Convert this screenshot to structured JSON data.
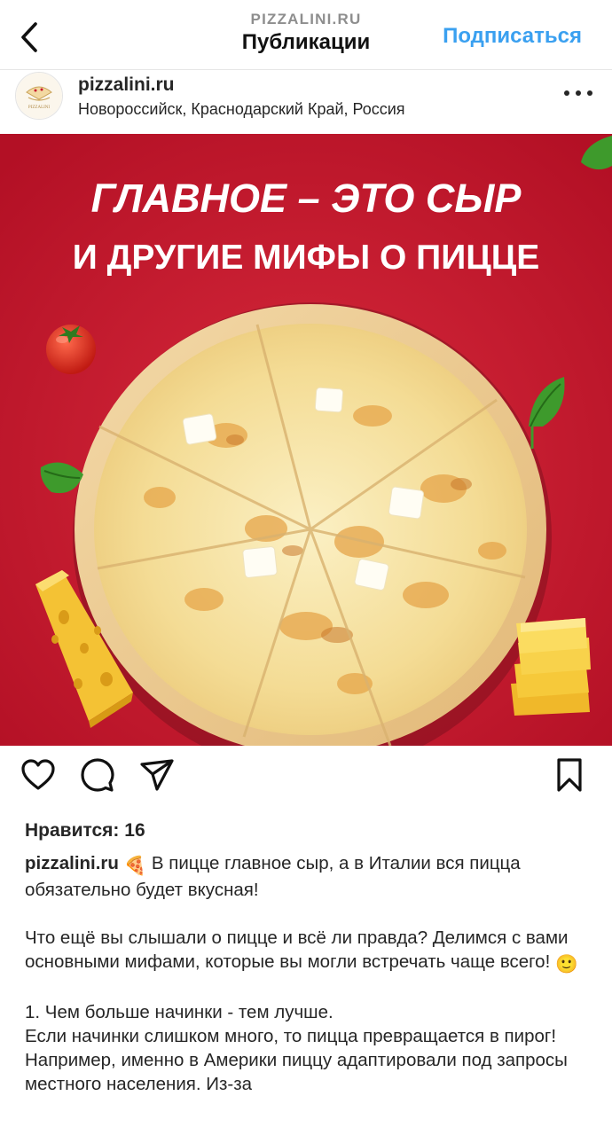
{
  "header": {
    "subtitle": "PIZZALINI.RU",
    "title": "Публикации",
    "follow_label": "Подписаться"
  },
  "post": {
    "username": "pizzalini.ru",
    "location": "Новороссийск, Краснодарский Край, Россия",
    "avatar_text": "PIZZALINI"
  },
  "image": {
    "headline_line1": "ГЛАВНОЕ – ЭТО СЫР",
    "headline_line2": "И ДРУГИЕ МИФЫ О ПИЦЦЕ",
    "background_color": "#c8172d"
  },
  "actions": {
    "like_icon": "heart-icon",
    "comment_icon": "comment-icon",
    "share_icon": "paper-plane-icon",
    "save_icon": "bookmark-icon"
  },
  "likes_text": "Нравится: 16",
  "caption": {
    "username": "pizzalini.ru",
    "emoji1": "🍕",
    "p1": "В пицце главное сыр, а в Италии вся пицца обязательно будет вкусная!",
    "p2": "Что ещё вы слышали о пицце и всё ли правда? Делимся с вами основными мифами, которые вы могли встречать чаще всего!",
    "emoji2": "🙂",
    "p3_line1": "1. Чем больше начинки - тем лучше.",
    "p3_rest": "Если начинки слишком много, то пицца превращается в пирог! Например, именно в Америки пиццу адаптировали под запросы местного населения. Из-за"
  }
}
